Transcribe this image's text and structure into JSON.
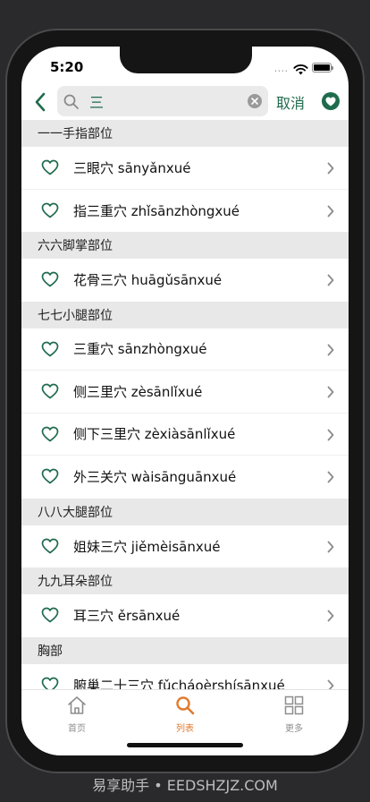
{
  "status": {
    "time": "5:20",
    "signal_glyph": "••••"
  },
  "search": {
    "value": "三",
    "cancel_label": "取消"
  },
  "sections": [
    {
      "title": "一一手指部位",
      "items": [
        "三眼穴 sānyǎnxué",
        "指三重穴 zhǐsānzhòngxué"
      ]
    },
    {
      "title": "六六脚掌部位",
      "items": [
        "花骨三穴 huāgǔsānxué"
      ]
    },
    {
      "title": "七七小腿部位",
      "items": [
        "三重穴 sānzhòngxué",
        "侧三里穴 zèsānlǐxué",
        "侧下三里穴 zèxiàsānlǐxué",
        "外三关穴 wàisānguānxué"
      ]
    },
    {
      "title": "八八大腿部位",
      "items": [
        "姐妹三穴 jiěmèisānxué"
      ]
    },
    {
      "title": "九九耳朵部位",
      "items": [
        "耳三穴 ěrsānxué"
      ]
    },
    {
      "title": "胸部",
      "items": [
        "腑巢二十三穴 fǔcháoèrshísānxué"
      ]
    }
  ],
  "tabs": {
    "home": "首页",
    "list": "列表",
    "more": "更多"
  },
  "colors": {
    "accent": "#1f6b4d",
    "active_tab": "#e07a2e",
    "inactive_tab": "#8e8e8e"
  },
  "watermark": "易享助手 • EEDSHZJZ.COM"
}
